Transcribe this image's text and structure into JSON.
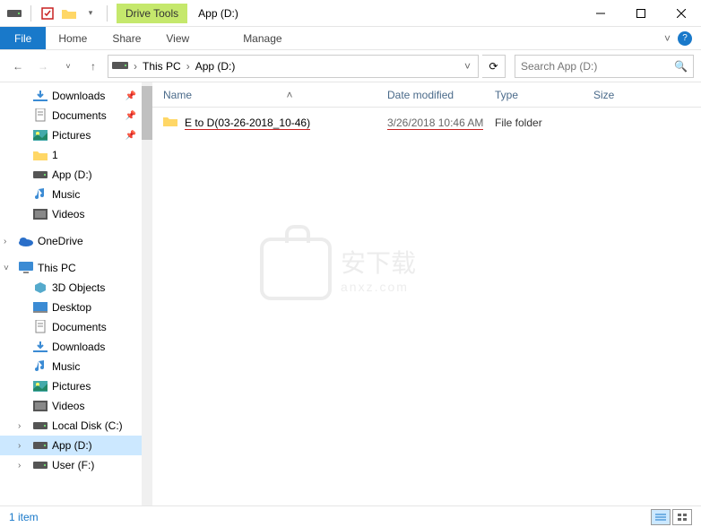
{
  "title": "App (D:)",
  "drive_tools_label": "Drive Tools",
  "ribbon": {
    "file": "File",
    "tabs": [
      "Home",
      "Share",
      "View"
    ],
    "contextual": "Manage"
  },
  "nav": {
    "breadcrumb": [
      "This PC",
      "App (D:)"
    ],
    "search_placeholder": "Search App (D:)"
  },
  "sidebar": {
    "items": [
      {
        "label": "Downloads",
        "icon": "download",
        "level": 1,
        "pinned": true
      },
      {
        "label": "Documents",
        "icon": "document",
        "level": 1,
        "pinned": true
      },
      {
        "label": "Pictures",
        "icon": "pictures",
        "level": 1,
        "pinned": true
      },
      {
        "label": "1",
        "icon": "folder",
        "level": 1
      },
      {
        "label": "App (D:)",
        "icon": "drive",
        "level": 1
      },
      {
        "label": "Music",
        "icon": "music",
        "level": 1
      },
      {
        "label": "Videos",
        "icon": "video",
        "level": 1
      },
      {
        "label": "OneDrive",
        "icon": "onedrive",
        "level": 0,
        "chevron": "right"
      },
      {
        "label": "This PC",
        "icon": "pc",
        "level": 0,
        "chevron": "down"
      },
      {
        "label": "3D Objects",
        "icon": "3d",
        "level": 1
      },
      {
        "label": "Desktop",
        "icon": "desktop",
        "level": 1
      },
      {
        "label": "Documents",
        "icon": "document",
        "level": 1
      },
      {
        "label": "Downloads",
        "icon": "download",
        "level": 1
      },
      {
        "label": "Music",
        "icon": "music",
        "level": 1
      },
      {
        "label": "Pictures",
        "icon": "pictures",
        "level": 1
      },
      {
        "label": "Videos",
        "icon": "video",
        "level": 1
      },
      {
        "label": "Local Disk (C:)",
        "icon": "drive",
        "level": 1,
        "chevron": "right"
      },
      {
        "label": "App (D:)",
        "icon": "drive",
        "level": 1,
        "chevron": "right",
        "selected": true
      },
      {
        "label": "User (F:)",
        "icon": "drive",
        "level": 1,
        "chevron": "right"
      }
    ]
  },
  "columns": {
    "name": "Name",
    "date": "Date modified",
    "type": "Type",
    "size": "Size"
  },
  "rows": [
    {
      "name": "E to D(03-26-2018_10-46)",
      "date": "3/26/2018 10:46 AM",
      "type": "File folder",
      "size": ""
    }
  ],
  "status": {
    "count": "1 item"
  },
  "watermark": {
    "line1": "安下载",
    "line2": "anxz.com"
  }
}
